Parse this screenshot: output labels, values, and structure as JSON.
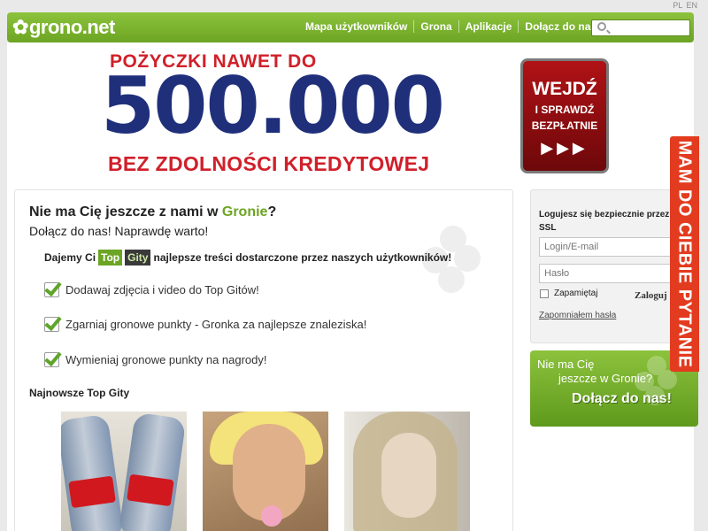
{
  "lang": [
    "PL",
    "EN"
  ],
  "header": {
    "logo_text": "grono.net",
    "nav": [
      "Mapa użytkowników",
      "Grona",
      "Aplikacje",
      "Dołącz do nas!"
    ],
    "search_placeholder": ""
  },
  "ad": {
    "line1": "POŻYCZKI NAWET DO",
    "amount": "500.000",
    "line3": "BEZ ZDOLNOŚCI KREDYTOWEJ",
    "cta_title": "WEJDŹ",
    "cta_sub1": "I SPRAWDŹ",
    "cta_sub2": "BEZPŁATNIE",
    "cta_arrows": "▶▶▶"
  },
  "main": {
    "title_start": "Nie ma Cię jeszcze z nami w ",
    "title_green": "Gronie",
    "title_end": "?",
    "subtitle": "Dołącz do nas! Naprawdę warto!",
    "topgity_prefix": "Dajemy Ci",
    "badge_top": "Top",
    "badge_gity": "Gity",
    "topgity_suffix": "najlepsze treści dostarczone przez naszych użytkowników!",
    "features": [
      "Dodawaj zdjęcia i video do Top Gitów!",
      "Zgarniaj gronowe punkty - Gronka za najlepsze znaleziska!",
      "Wymieniaj gronowe punkty na nagrody!"
    ],
    "latest_title": "Najnowsze Top Gity"
  },
  "login": {
    "title": "Logujesz się bezpiecznie przez SSL",
    "login_placeholder": "Login/E-mail",
    "password_placeholder": "Hasło",
    "remember": "Zapamiętaj",
    "submit": "Zaloguj",
    "forgot": "Zapomniałem hasła"
  },
  "join_box": {
    "line1": "Nie ma Cię",
    "line2": "jeszcze w Gronie?",
    "cta": "Dołącz do nas!"
  },
  "side_tab": "MAM DO CIEBIE PYTANIE",
  "colors": {
    "brand_green": "#6ca523",
    "ad_red": "#d0202a",
    "ad_blue": "#1f2f7a",
    "side_tab": "#e33b1f"
  }
}
